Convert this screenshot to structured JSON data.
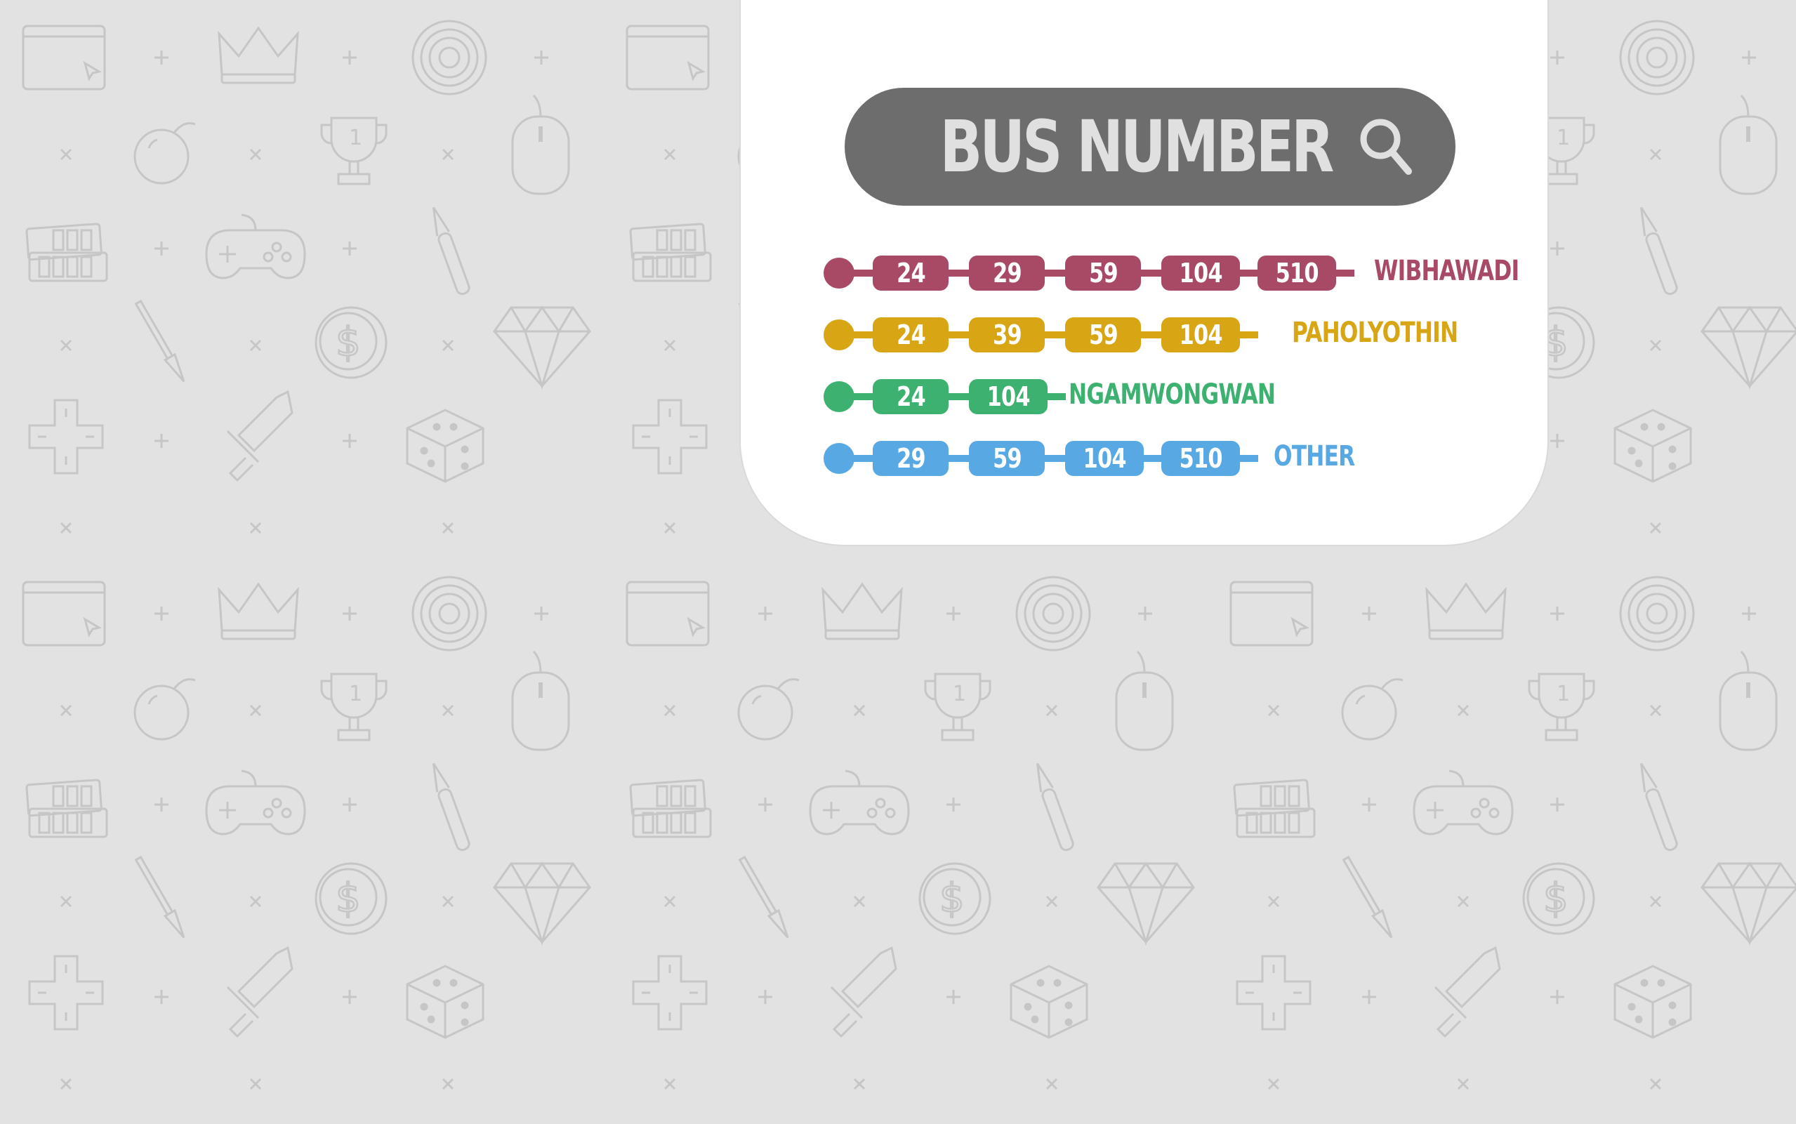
{
  "background": {
    "pattern_icons": [
      "browser-window-icon",
      "crown-icon",
      "target-icon",
      "trophy-icon",
      "bomb-icon",
      "mouse-icon",
      "gamepad-icon",
      "memory-card-icon",
      "pen-icon",
      "brush-icon",
      "coin-dollar-icon",
      "diamond-icon",
      "dpad-icon",
      "sword-icon",
      "dice-icon",
      "plus-icon",
      "cross-icon"
    ],
    "color": "#e2e2e2",
    "icon_color": "#c6c6c6"
  },
  "search": {
    "title": "BUS NUMBER",
    "icon": "magnifier-icon",
    "bg_color": "#6d6d6d",
    "text_color": "#e0e0e0"
  },
  "routes": [
    {
      "color": "#a84a66",
      "buses": [
        "24",
        "29",
        "59",
        "104",
        "510"
      ],
      "destination": "WIBHAWADI"
    },
    {
      "color": "#d8a514",
      "buses": [
        "24",
        "39",
        "59",
        "104"
      ],
      "destination": "PAHOLYOTHIN"
    },
    {
      "color": "#3cb170",
      "buses": [
        "24",
        "104"
      ],
      "destination": "NGAMWONGWAN"
    },
    {
      "color": "#57a8e3",
      "buses": [
        "29",
        "59",
        "104",
        "510"
      ],
      "destination": "OTHER"
    }
  ]
}
